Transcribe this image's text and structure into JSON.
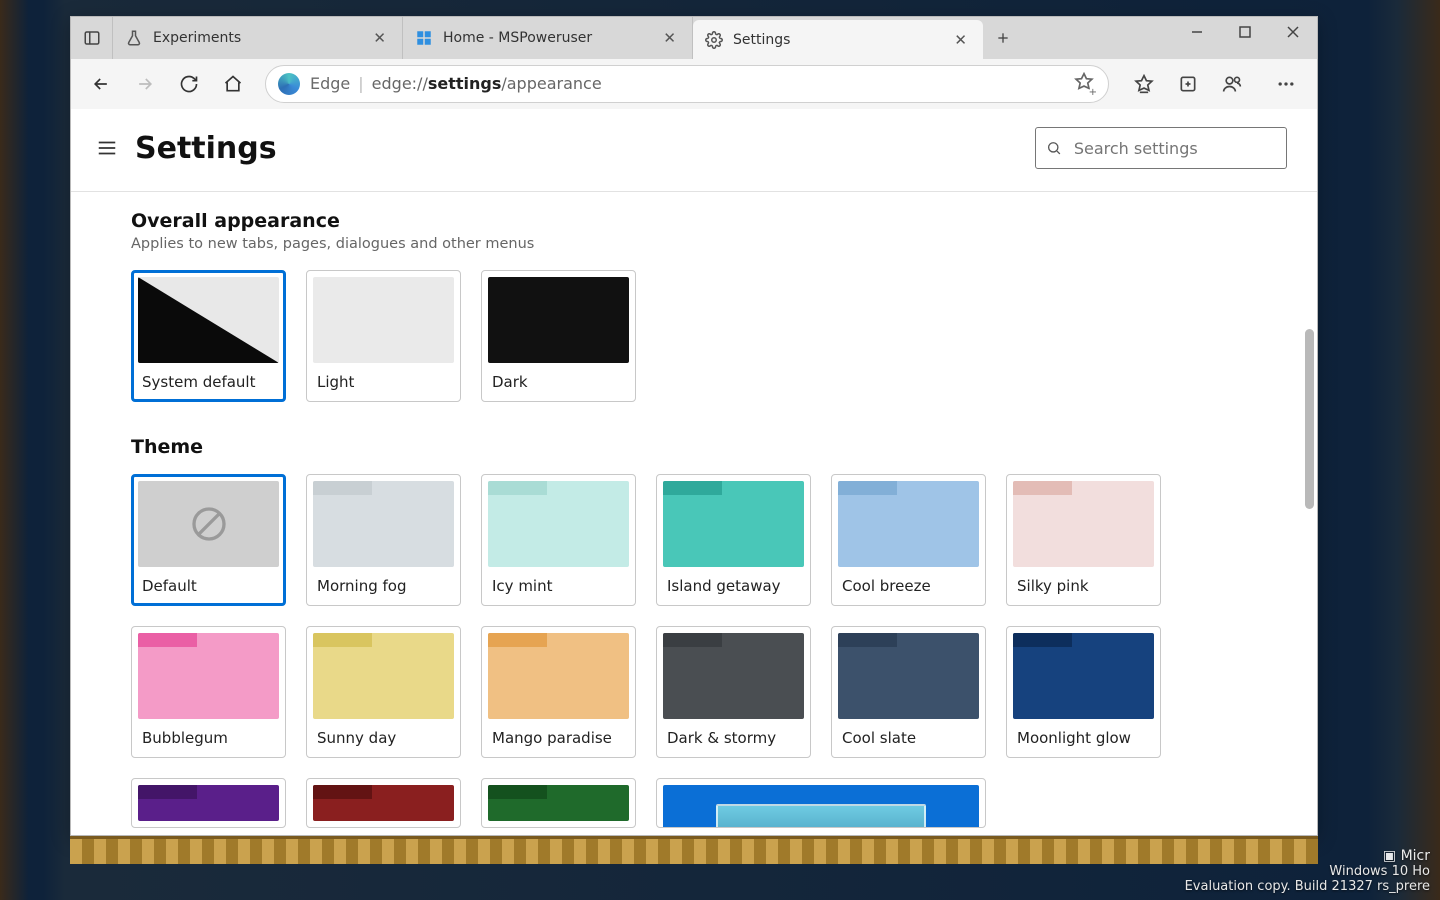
{
  "window": {
    "minimize": "–",
    "maximize": "▢",
    "close": "✕"
  },
  "tabs": {
    "items": [
      {
        "label": "Experiments",
        "icon": "flask-icon"
      },
      {
        "label": "Home - MSPoweruser",
        "icon": "windows-icon"
      },
      {
        "label": "Settings",
        "icon": "gear-icon"
      }
    ],
    "active_index": 2,
    "new_tab": "+"
  },
  "toolbar": {
    "edge_label": "Edge",
    "url_prefix": "edge://",
    "url_bold": "settings",
    "url_suffix": "/appearance"
  },
  "settings": {
    "page_title": "Settings",
    "search_placeholder": "Search settings",
    "overall": {
      "title": "Overall appearance",
      "subtitle": "Applies to new tabs, pages, dialogues and other menus",
      "options": [
        {
          "label": "System default",
          "kind": "system",
          "selected": true
        },
        {
          "label": "Light",
          "kind": "light"
        },
        {
          "label": "Dark",
          "kind": "dark"
        }
      ]
    },
    "theme": {
      "title": "Theme",
      "options": [
        {
          "label": "Default",
          "main": "#cfcfcf",
          "default": true,
          "selected": true
        },
        {
          "label": "Morning fog",
          "main": "#d7dde1",
          "tab": "#c8cfd3"
        },
        {
          "label": "Icy mint",
          "main": "#c3ebe6",
          "tab": "#a9dcd5"
        },
        {
          "label": "Island getaway",
          "main": "#49c7b8",
          "tab": "#2fa99b"
        },
        {
          "label": "Cool breeze",
          "main": "#9fc4e7",
          "tab": "#82afd7"
        },
        {
          "label": "Silky pink",
          "main": "#f2dedd",
          "tab": "#e3bcb6"
        },
        {
          "label": "Bubblegum",
          "main": "#f49bc7",
          "tab": "#ea5fa5"
        },
        {
          "label": "Sunny day",
          "main": "#e9d989",
          "tab": "#d9c55f"
        },
        {
          "label": "Mango paradise",
          "main": "#f0c083",
          "tab": "#e6a452"
        },
        {
          "label": "Dark & stormy",
          "main": "#4a4e52",
          "tab": "#3a3e42"
        },
        {
          "label": "Cool slate",
          "main": "#3c516b",
          "tab": "#2d4058"
        },
        {
          "label": "Moonlight glow",
          "main": "#16427e",
          "tab": "#0d2e5c"
        }
      ],
      "row3": [
        {
          "main": "#5a1f8a",
          "tab": "#431568"
        },
        {
          "main": "#8a1f1f",
          "tab": "#631313"
        },
        {
          "main": "#1f6a2b",
          "tab": "#14511e"
        }
      ]
    }
  },
  "watermark": {
    "line1": "Windows 10 Ho",
    "line2": "Evaluation copy. Build 21327 rs_prere",
    "brand": "Micr"
  }
}
